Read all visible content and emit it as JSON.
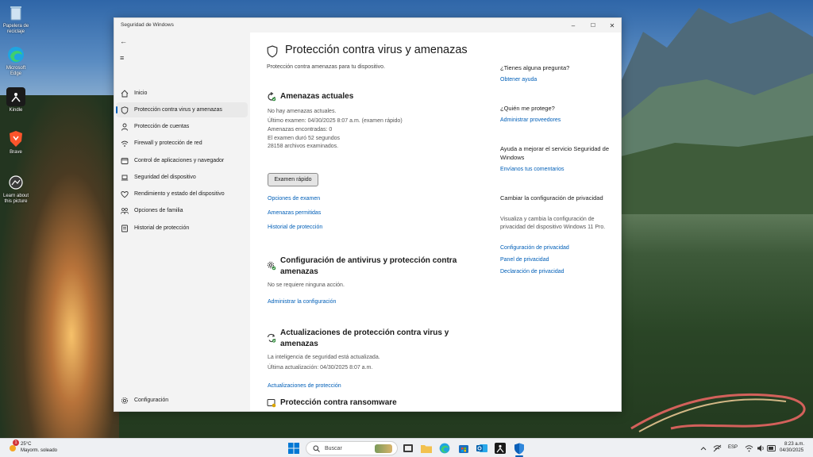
{
  "desktop": {
    "icons": [
      {
        "label": "Papelera de reciclaje",
        "icon": "recycle-bin-icon"
      },
      {
        "label": "Microsoft Edge",
        "icon": "edge-icon"
      },
      {
        "label": "Kindle",
        "icon": "kindle-icon"
      },
      {
        "label": "Brave",
        "icon": "brave-icon"
      },
      {
        "label": "Learn about this picture",
        "icon": "learn-picture-icon"
      }
    ]
  },
  "window": {
    "title": "Seguridad de Windows",
    "controls": {
      "minimize": "–",
      "maximize": "☐",
      "close": "✕"
    }
  },
  "nav": {
    "back": "←",
    "menu": "≡",
    "items": [
      {
        "label": "Inicio",
        "icon": "home-icon"
      },
      {
        "label": "Protección contra virus y amenazas",
        "icon": "shield-icon",
        "active": true
      },
      {
        "label": "Protección de cuentas",
        "icon": "person-icon"
      },
      {
        "label": "Firewall y protección de red",
        "icon": "wifi-icon"
      },
      {
        "label": "Control de aplicaciones y navegador",
        "icon": "browser-icon"
      },
      {
        "label": "Seguridad del dispositivo",
        "icon": "laptop-icon"
      },
      {
        "label": "Rendimiento y estado del dispositivo",
        "icon": "heart-icon"
      },
      {
        "label": "Opciones de familia",
        "icon": "family-icon"
      },
      {
        "label": "Historial de protección",
        "icon": "history-icon"
      }
    ],
    "settings": "Configuración"
  },
  "main": {
    "title": "Protección contra virus y amenazas",
    "subtitle": "Protección contra amenazas para tu dispositivo.",
    "threats": {
      "title": "Amenazas actuales",
      "lines": [
        "No hay amenazas actuales.",
        "Último examen: 04/30/2025 8:07 a.m. (examen rápido)",
        "Amenazas encontradas: 0",
        "El examen duró 52 segundos",
        "28158 archivos examinados."
      ],
      "scan_button": "Examen rápido",
      "links": [
        "Opciones de examen",
        "Amenazas permitidas",
        "Historial de protección"
      ]
    },
    "settings_section": {
      "title": "Configuración de antivirus y protección contra amenazas",
      "line": "No se requiere ninguna acción.",
      "link": "Administrar la configuración"
    },
    "updates": {
      "title": "Actualizaciones de protección contra virus y amenazas",
      "lines": [
        "La inteligencia de seguridad está actualizada.",
        "Última actualización: 04/30/2025 8:07 a.m."
      ],
      "link": "Actualizaciones de protección"
    },
    "ransomware": {
      "title": "Protección contra ransomware"
    }
  },
  "side": {
    "question": "¿Tienes alguna pregunta?",
    "help_link": "Obtener ayuda",
    "who": "¿Quién me protege?",
    "providers_link": "Administrar proveedores",
    "improve": "Ayuda a mejorar el servicio Seguridad de Windows",
    "feedback_link": "Envíanos tus comentarios",
    "privacy_title": "Cambiar la configuración de privacidad",
    "privacy_text": "Visualiza y cambia la configuración de privacidad del dispositivo Windows 11 Pro.",
    "privacy_links": [
      "Configuración de privacidad",
      "Panel de privacidad",
      "Declaración de privacidad"
    ]
  },
  "taskbar": {
    "weather_temp": "25°C",
    "weather_desc": "Mayorm. soleado",
    "weather_badge": "1",
    "search_placeholder": "Buscar",
    "lang": "ESP",
    "time": "8:23 a.m.",
    "date": "04/30/2025"
  },
  "colors": {
    "accent": "#005fb8",
    "nav_bg": "#f3f3f3",
    "shield_blue": "#0a5fb8"
  }
}
